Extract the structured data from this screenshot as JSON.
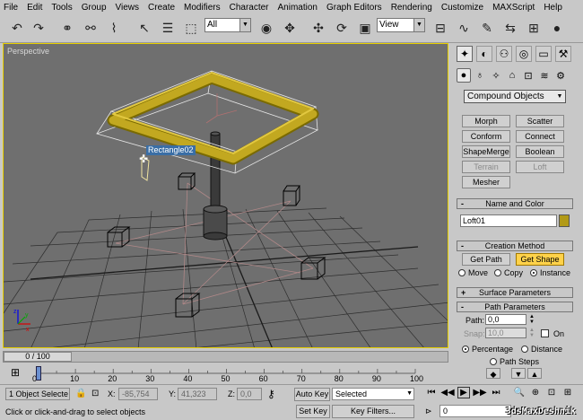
{
  "menu": [
    "File",
    "Edit",
    "Tools",
    "Group",
    "Views",
    "Create",
    "Modifiers",
    "Character",
    "Animation",
    "Graph Editors",
    "Rendering",
    "Customize",
    "MAXScript",
    "Help"
  ],
  "toolbar": {
    "selection_filter": "All",
    "ref_coord": "View"
  },
  "viewport": {
    "label": "Perspective",
    "object_tooltip": "Rectangle02"
  },
  "command_panel": {
    "category": "Compound Objects",
    "object_type_buttons": [
      {
        "label": "Morph",
        "state": "normal"
      },
      {
        "label": "Scatter",
        "state": "normal"
      },
      {
        "label": "Conform",
        "state": "normal"
      },
      {
        "label": "Connect",
        "state": "normal"
      },
      {
        "label": "ShapeMerge",
        "state": "normal"
      },
      {
        "label": "Boolean",
        "state": "normal"
      },
      {
        "label": "Terrain",
        "state": "disabled"
      },
      {
        "label": "Loft",
        "state": "disabled"
      },
      {
        "label": "Mesher",
        "state": "normal"
      }
    ],
    "name_and_color": {
      "header": "Name and Color",
      "name": "Loft01",
      "color": "#b29a17"
    },
    "creation_method": {
      "header": "Creation Method",
      "get_path": "Get Path",
      "get_shape": "Get Shape",
      "move": "Move",
      "copy": "Copy",
      "instance": "Instance",
      "selected": "Instance"
    },
    "surface_parameters": {
      "header": "Surface Parameters"
    },
    "path_parameters": {
      "header": "Path Parameters",
      "path_label": "Path:",
      "path_value": "0,0",
      "snap_label": "Snap:",
      "snap_value": "10,0",
      "on_label": "On",
      "percentage": "Percentage",
      "distance": "Distance",
      "path_steps": "Path Steps",
      "selected": "Percentage"
    }
  },
  "timeline": {
    "slider_label": "0 / 100",
    "ticks": [
      "0",
      "10",
      "20",
      "30",
      "40",
      "50",
      "60",
      "70",
      "80",
      "90",
      "100"
    ]
  },
  "status": {
    "selection": "1 Object Selecte",
    "x_label": "X:",
    "x_value": "-85,754",
    "y_label": "Y:",
    "y_value": "41,323",
    "z_label": "Z:",
    "z_value": "0,0",
    "auto_key": "Auto Key",
    "set_key": "Set Key",
    "key_mode": "Selected",
    "key_filters": "Key Filters...",
    "prompt": "Click or click-and-drag to select objects",
    "frame": "0"
  },
  "watermark": "3dsMaxDeshnik",
  "colors": {
    "viewport_bg": "#6f6f6f",
    "active_border": "#e8d000",
    "object_color": "#b29a17",
    "active_button": "#ffd24a"
  }
}
